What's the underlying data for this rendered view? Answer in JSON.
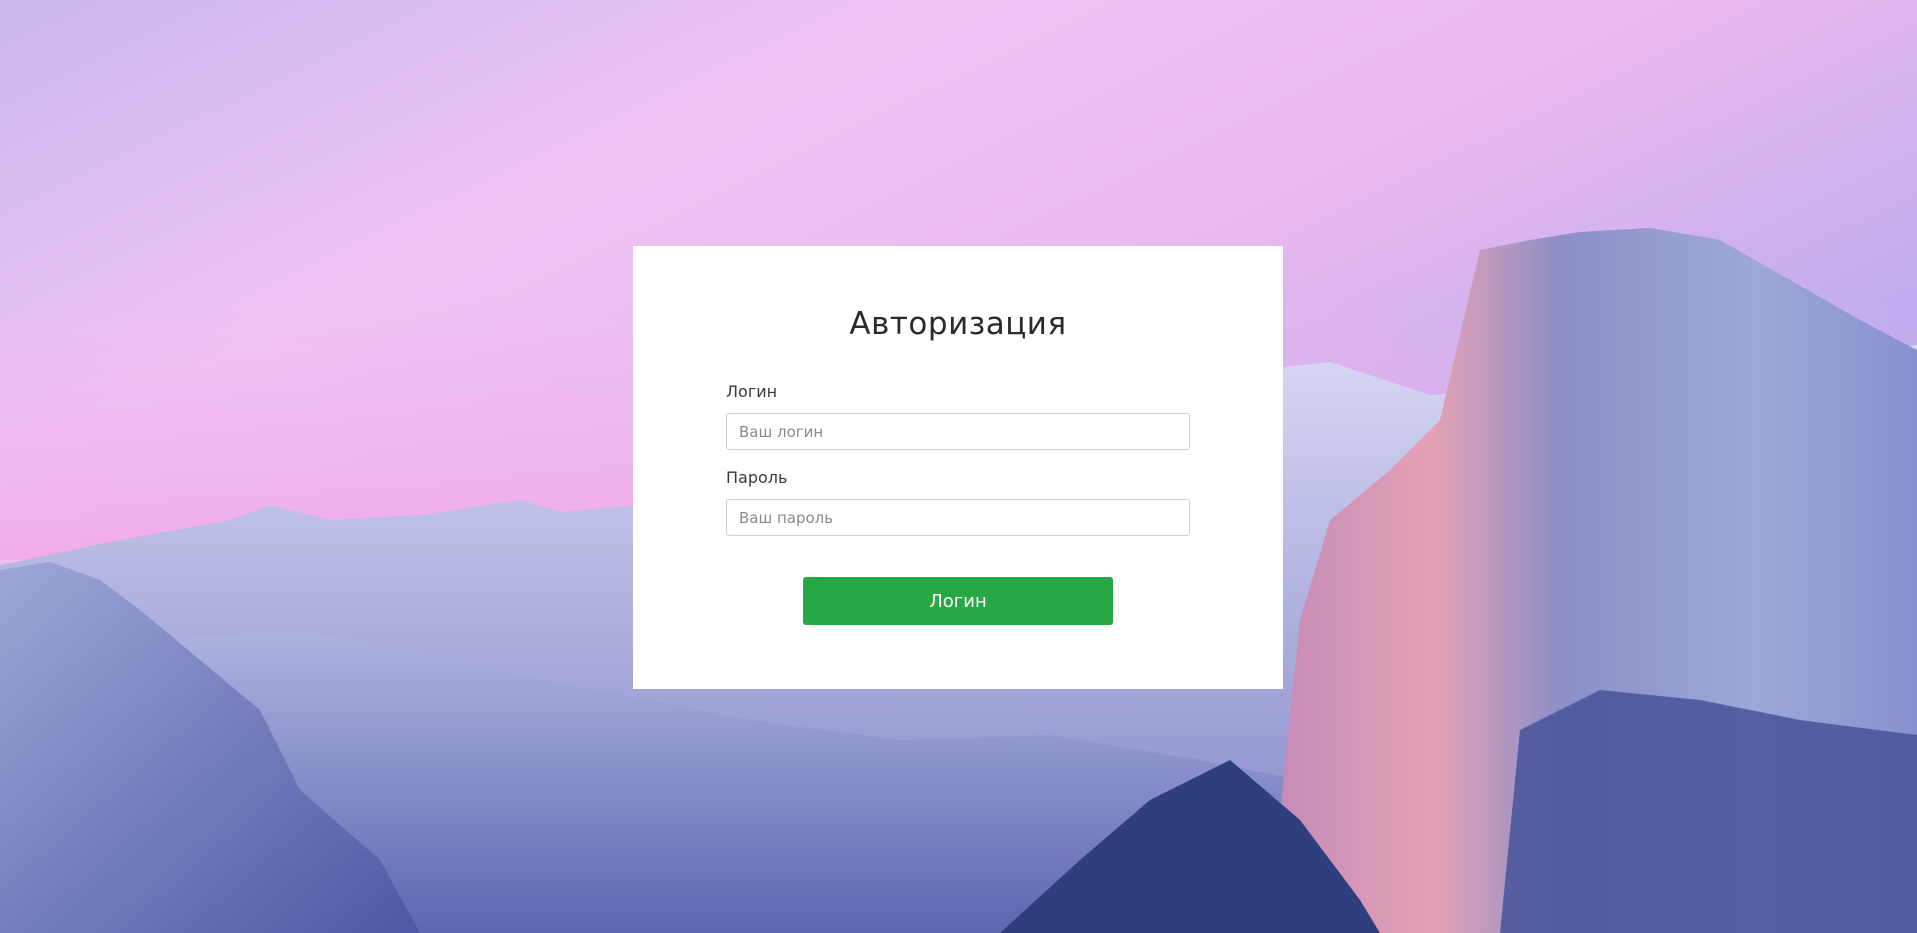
{
  "login_form": {
    "title": "Авторизация",
    "login_label": "Логин",
    "login_placeholder": "Ваш логин",
    "login_value": "",
    "password_label": "Пароль",
    "password_placeholder": "Ваш пароль",
    "password_value": "",
    "submit_label": "Логин"
  },
  "colors": {
    "submit_button": "#28a745",
    "card_background": "#ffffff"
  }
}
